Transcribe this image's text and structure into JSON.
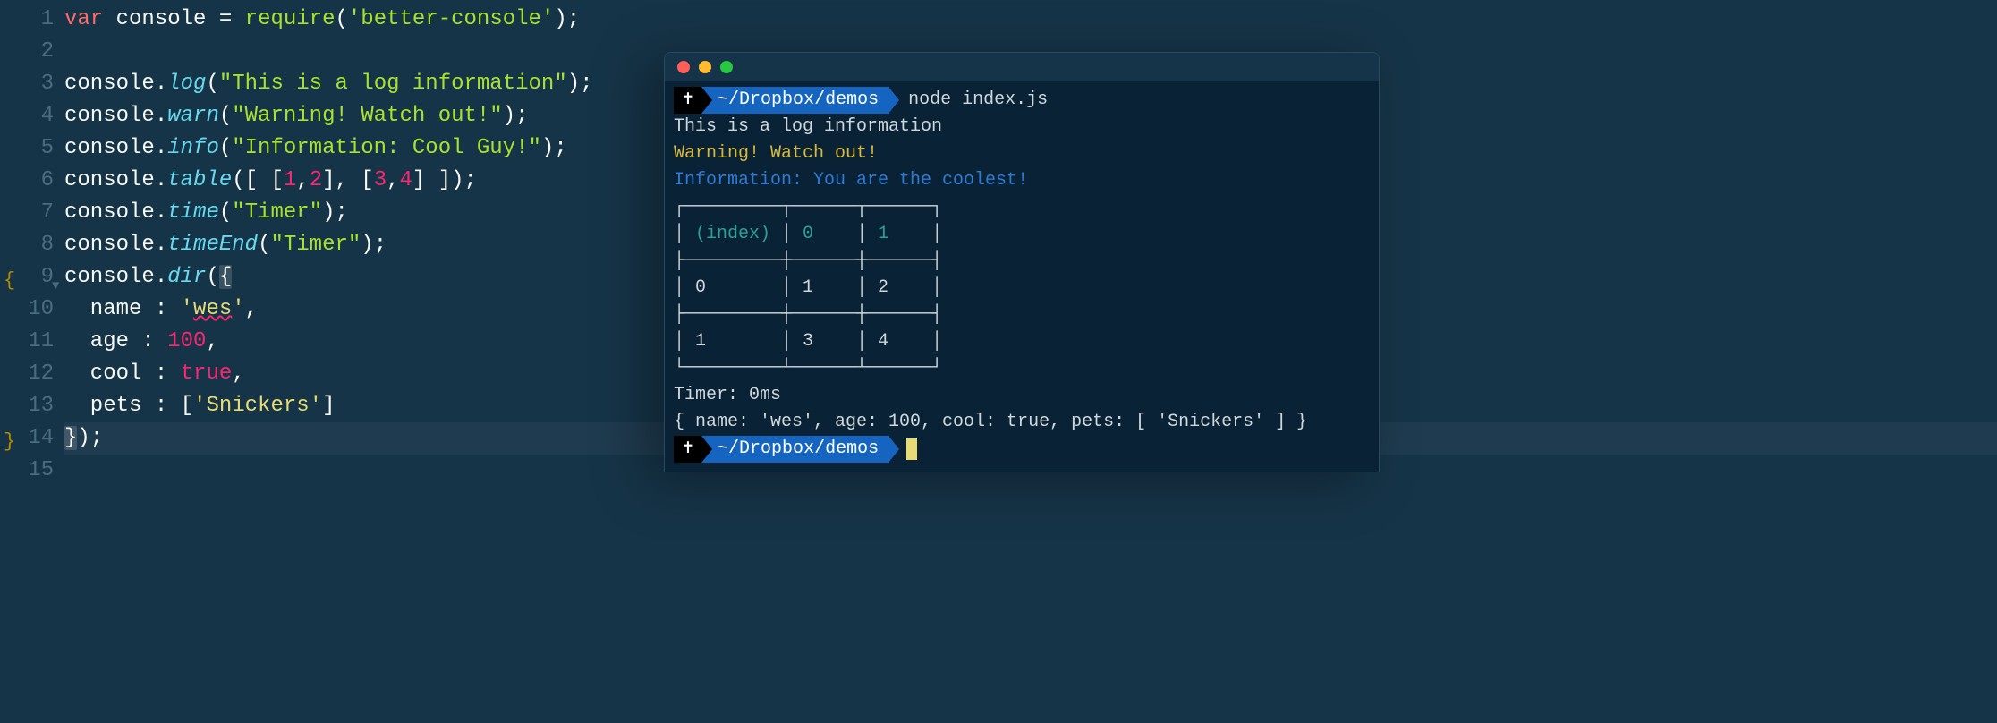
{
  "editor": {
    "lines": [
      {
        "n": "1",
        "frag": [
          [
            "var",
            "tk-var"
          ],
          [
            " ",
            "tk-op"
          ],
          [
            "console",
            "tk-ident"
          ],
          [
            " ",
            "tk-op"
          ],
          [
            "=",
            "tk-op"
          ],
          [
            " ",
            "tk-op"
          ],
          [
            "require",
            "tk-func"
          ],
          [
            "(",
            "tk-punct"
          ],
          [
            "'better-console'",
            "tk-str"
          ],
          [
            ")",
            "tk-punct"
          ],
          [
            ";",
            "tk-punct"
          ]
        ]
      },
      {
        "n": "2",
        "frag": []
      },
      {
        "n": "3",
        "frag": [
          [
            "console",
            "tk-ident"
          ],
          [
            ".",
            "tk-punct"
          ],
          [
            "log",
            "tk-method"
          ],
          [
            "(",
            "tk-punct"
          ],
          [
            "\"This is a log information\"",
            "tk-str"
          ],
          [
            ")",
            "tk-punct"
          ],
          [
            ";",
            "tk-punct"
          ]
        ]
      },
      {
        "n": "4",
        "frag": [
          [
            "console",
            "tk-ident"
          ],
          [
            ".",
            "tk-punct"
          ],
          [
            "warn",
            "tk-method"
          ],
          [
            "(",
            "tk-punct"
          ],
          [
            "\"Warning! Watch out!\"",
            "tk-str"
          ],
          [
            ")",
            "tk-punct"
          ],
          [
            ";",
            "tk-punct"
          ]
        ]
      },
      {
        "n": "5",
        "frag": [
          [
            "console",
            "tk-ident"
          ],
          [
            ".",
            "tk-punct"
          ],
          [
            "info",
            "tk-method"
          ],
          [
            "(",
            "tk-punct"
          ],
          [
            "\"Information: Cool Guy!\"",
            "tk-str"
          ],
          [
            ")",
            "tk-punct"
          ],
          [
            ";",
            "tk-punct"
          ]
        ]
      },
      {
        "n": "6",
        "frag": [
          [
            "console",
            "tk-ident"
          ],
          [
            ".",
            "tk-punct"
          ],
          [
            "table",
            "tk-method"
          ],
          [
            "(",
            "tk-punct"
          ],
          [
            "[ [",
            "tk-punct"
          ],
          [
            "1",
            "tk-num"
          ],
          [
            ",",
            "tk-punct"
          ],
          [
            "2",
            "tk-num"
          ],
          [
            "], [",
            "tk-punct"
          ],
          [
            "3",
            "tk-num"
          ],
          [
            ",",
            "tk-punct"
          ],
          [
            "4",
            "tk-num"
          ],
          [
            "] ]",
            "tk-punct"
          ],
          [
            ")",
            "tk-punct"
          ],
          [
            ";",
            "tk-punct"
          ]
        ]
      },
      {
        "n": "7",
        "frag": [
          [
            "console",
            "tk-ident"
          ],
          [
            ".",
            "tk-punct"
          ],
          [
            "time",
            "tk-method"
          ],
          [
            "(",
            "tk-punct"
          ],
          [
            "\"Timer\"",
            "tk-str"
          ],
          [
            ")",
            "tk-punct"
          ],
          [
            ";",
            "tk-punct"
          ]
        ]
      },
      {
        "n": "8",
        "frag": [
          [
            "console",
            "tk-ident"
          ],
          [
            ".",
            "tk-punct"
          ],
          [
            "timeEnd",
            "tk-method"
          ],
          [
            "(",
            "tk-punct"
          ],
          [
            "\"Timer\"",
            "tk-str"
          ],
          [
            ")",
            "tk-punct"
          ],
          [
            ";",
            "tk-punct"
          ]
        ]
      },
      {
        "n": "9",
        "frag": [
          [
            "console",
            "tk-ident"
          ],
          [
            ".",
            "tk-punct"
          ],
          [
            "dir",
            "tk-method"
          ],
          [
            "(",
            "tk-punct"
          ],
          [
            "{",
            "tk-punct brace-hl"
          ]
        ],
        "braceOpen": true,
        "fold": true
      },
      {
        "n": "10",
        "frag": [
          [
            "  name ",
            "tk-prop"
          ],
          [
            ":",
            "tk-punct"
          ],
          [
            " ",
            "tk-op"
          ],
          [
            "'",
            "tk-strq"
          ],
          [
            "wes",
            "tk-strq underline-wavy"
          ],
          [
            "'",
            "tk-strq"
          ],
          [
            ",",
            "tk-punct"
          ]
        ]
      },
      {
        "n": "11",
        "frag": [
          [
            "  age ",
            "tk-prop"
          ],
          [
            ":",
            "tk-punct"
          ],
          [
            " ",
            "tk-op"
          ],
          [
            "100",
            "tk-num"
          ],
          [
            ",",
            "tk-punct"
          ]
        ]
      },
      {
        "n": "12",
        "frag": [
          [
            "  cool ",
            "tk-prop"
          ],
          [
            ":",
            "tk-punct"
          ],
          [
            " ",
            "tk-op"
          ],
          [
            "true",
            "tk-bool"
          ],
          [
            ",",
            "tk-punct"
          ]
        ]
      },
      {
        "n": "13",
        "frag": [
          [
            "  pets ",
            "tk-prop"
          ],
          [
            ":",
            "tk-punct"
          ],
          [
            " ",
            "tk-op"
          ],
          [
            "[",
            "tk-punct"
          ],
          [
            "'Snickers'",
            "tk-strq"
          ],
          [
            "]",
            "tk-punct"
          ]
        ]
      },
      {
        "n": "14",
        "frag": [
          [
            "}",
            "tk-punct brace-hl"
          ],
          [
            ")",
            "tk-punct"
          ],
          [
            ";",
            "tk-punct"
          ]
        ],
        "braceClose": true,
        "hl": true
      },
      {
        "n": "15",
        "frag": []
      }
    ]
  },
  "terminal": {
    "prompt_symbol": "✝",
    "prompt_path": "~/Dropbox/demos",
    "command": "node index.js",
    "output": [
      {
        "text": "This is a log information",
        "cls": "out-white"
      },
      {
        "text": "Warning! Watch out!",
        "cls": "out-yellow"
      },
      {
        "text": "Information: You are the coolest!",
        "cls": "out-cyan"
      }
    ],
    "table": {
      "border_top": "┌─────────┬──────┬──────┐",
      "header": "│ (index) │ 0    │ 1    │",
      "sep": "├─────────┼──────┼──────┤",
      "row0": "│ 0       │ 1    │ 2    │",
      "row1": "│ 1       │ 3    │ 4    │",
      "border_bot": "└─────────┴──────┴──────┘"
    },
    "timer": "Timer: 0ms",
    "dir": "{ name: 'wes', age: 100, cool: true, pets: [ 'Snickers' ] }"
  }
}
